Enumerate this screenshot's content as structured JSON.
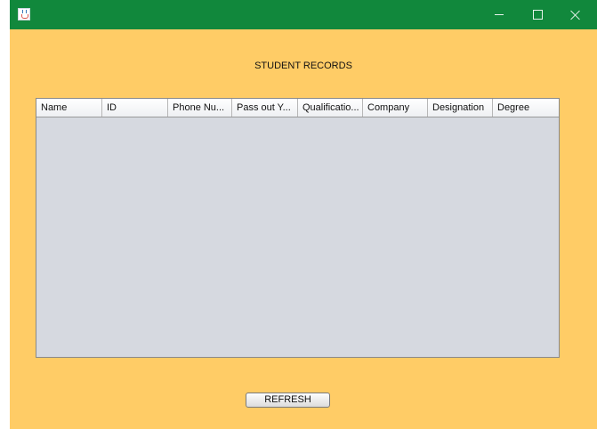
{
  "window": {
    "title": "",
    "controls": {
      "minimize": "minimize-icon",
      "maximize": "maximize-icon",
      "close": "close-icon"
    }
  },
  "colors": {
    "titlebar": "#11883C",
    "background": "#FFCC66",
    "table_body": "#D6D9E0"
  },
  "page": {
    "title": "STUDENT RECORDS"
  },
  "table": {
    "columns": [
      "Name",
      "ID",
      "Phone Nu...",
      "Pass out Y...",
      "Qualificatio...",
      "Company",
      "Designation",
      "Degree"
    ],
    "rows": []
  },
  "buttons": {
    "refresh": "REFRESH"
  }
}
